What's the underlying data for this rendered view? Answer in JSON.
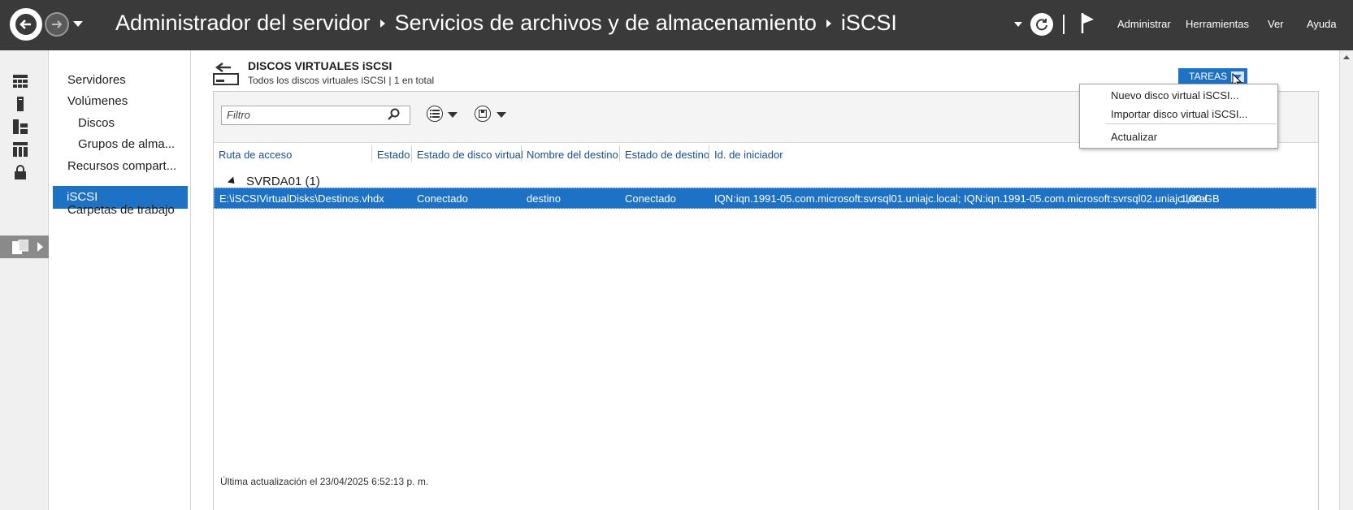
{
  "titlebar": {
    "breadcrumb": [
      "Administrador del servidor",
      "Servicios de archivos y de almacenamiento",
      "iSCSI"
    ],
    "menu": [
      "Administrar",
      "Herramientas",
      "Ver",
      "Ayuda"
    ]
  },
  "subnav": {
    "items": [
      "Servidores",
      "Volúmenes",
      "Discos",
      "Grupos de alma...",
      "Recursos compart...",
      "iSCSI",
      "Carpetas de trabajo"
    ],
    "selected": "iSCSI"
  },
  "section": {
    "title": "DISCOS VIRTUALES iSCSI",
    "subtitle": "Todos los discos virtuales iSCSI | 1 en total"
  },
  "filter": {
    "placeholder": "Filtro"
  },
  "tasks": {
    "label": "TAREAS",
    "menu": [
      "Nuevo disco virtual iSCSI...",
      "Importar disco virtual iSCSI...",
      "Actualizar"
    ]
  },
  "table": {
    "columns": [
      "Ruta de acceso",
      "Estado",
      "Estado de disco virtual",
      "Nombre del destino",
      "Estado de destino",
      "Id. de iniciador"
    ],
    "group": "SVRDA01 (1)",
    "rows": [
      {
        "path": "E:\\iSCSIVirtualDisks\\Destinos.vhdx",
        "status": "",
        "disk_status": "Conectado",
        "target_name": "destino",
        "target_status": "Conectado",
        "initiator": "IQN:iqn.1991-05.com.microsoft:svrsql01.uniajc.local; IQN:iqn.1991-05.com.microsoft:svrsql02.uniajc.local",
        "size": "1,00 GB"
      }
    ]
  },
  "status_bar": "Última actualización el 23/04/2025 6:52:13 p. m.",
  "colors": {
    "accent": "#1e72c6",
    "titlebar": "#3a3a3a"
  }
}
